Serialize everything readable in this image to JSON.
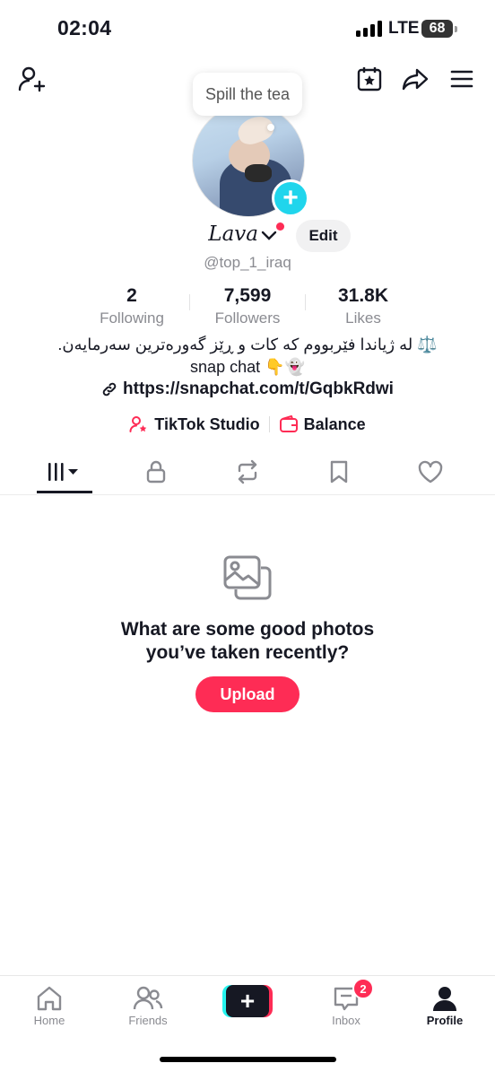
{
  "status_bar": {
    "time": "02:04",
    "network": "LTE",
    "battery": "68"
  },
  "top_bar": {
    "add_friend_icon": "person-plus-icon",
    "calendar_icon": "calendar-star-icon",
    "share_icon": "share-arrow-icon",
    "menu_icon": "hamburger-menu-icon"
  },
  "profile": {
    "bubble_text": "Spill the tea",
    "display_name": "Lava",
    "edit_label": "Edit",
    "username": "@top_1_iraq",
    "stats": [
      {
        "value": "2",
        "label": "Following"
      },
      {
        "value": "7,599",
        "label": "Followers"
      },
      {
        "value": "31.8K",
        "label": "Likes"
      }
    ],
    "bio_line1": "⚖️ لە ژیاندا فێربووم کە کات و ڕێز گەورەترین سەرمایەن.",
    "bio_line2": "snap chat 👇👻",
    "link": "https://snapchat.com/t/GqbkRdwi",
    "tools": {
      "studio": "TikTok Studio",
      "balance": "Balance"
    }
  },
  "tabs": [
    "videos-grid-icon",
    "lock-icon",
    "repost-icon",
    "bookmark-icon",
    "heart-icon"
  ],
  "empty_state": {
    "title_line1": "What are some good photos",
    "title_line2": "you’ve taken recently?",
    "upload_label": "Upload"
  },
  "bottom_nav": {
    "home": "Home",
    "friends": "Friends",
    "inbox": "Inbox",
    "inbox_badge": "2",
    "profile": "Profile"
  },
  "colors": {
    "accent": "#fe2c55",
    "cyan": "#20d5ec",
    "text": "#161823",
    "muted": "#8a8b91"
  }
}
